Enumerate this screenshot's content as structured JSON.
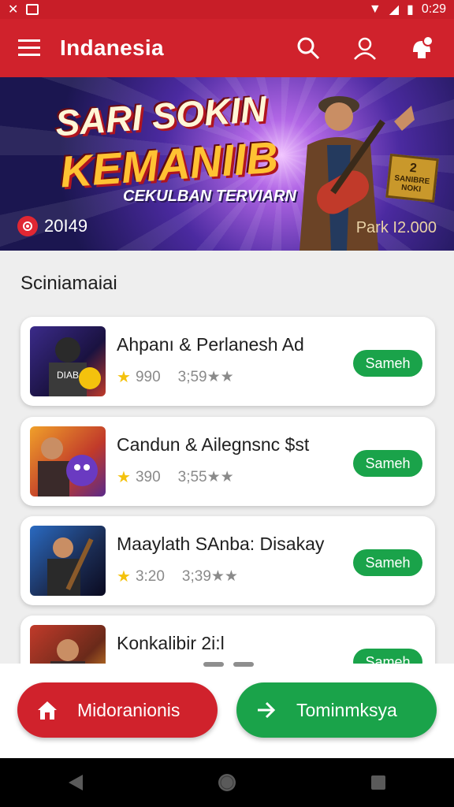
{
  "status_bar": {
    "time": "0:29"
  },
  "app_bar": {
    "title": "Indanesia",
    "icons": [
      "menu-icon",
      "search-icon",
      "user-icon",
      "notification-icon"
    ]
  },
  "banner": {
    "headline_line1": "SARI SOKIN",
    "headline_line2": "KEMANIIB",
    "subtitle": "CEKULBAN TERVIARN",
    "count": "20I49",
    "price": "Park I2.000",
    "box_text_top": "2",
    "box_text_bottom": "SANIBRE NOKI"
  },
  "section": {
    "title": "Sciniamaiai"
  },
  "cards": [
    {
      "name": "Ahpanı & Perlanesh Ad",
      "rating": "990",
      "date": "3;59★★",
      "button": "Sameh"
    },
    {
      "name": "Candun & Ailegnsnc $st",
      "rating": "390",
      "date": "3;55★★",
      "button": "Sameh"
    },
    {
      "name": "Maaylath SAnba: Disakay",
      "rating": "3:20",
      "date": "3;39★★",
      "button": "Sameh"
    },
    {
      "name": "Konkalibir 2i:l",
      "rating": "",
      "date": "",
      "button": "Sameh"
    }
  ],
  "bottom_actions": {
    "left_label": "Midoranionis",
    "right_label": "Tominmksya"
  },
  "colors": {
    "primary_red": "#d0222c",
    "accent_green": "#1aa34a",
    "star_yellow": "#f4c20d"
  }
}
